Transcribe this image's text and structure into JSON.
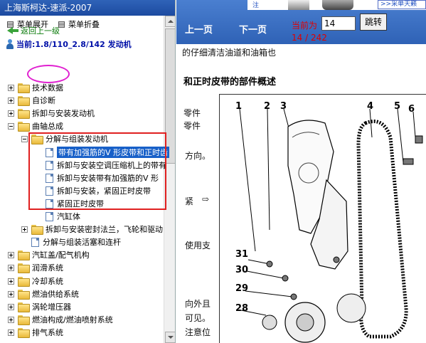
{
  "left_panel": {
    "title": "上海斯柯达-速派-2007",
    "expand_all": "菜单展开",
    "collapse_all": "菜单折叠",
    "back_link": "返回上一级",
    "current_path": "当前:1.8/110_2.8/142 发动机",
    "tree": [
      {
        "label": "技术数据",
        "level": 0,
        "type": "folder",
        "expander": "plus"
      },
      {
        "label": "自诊断",
        "level": 0,
        "type": "folder",
        "expander": "plus"
      },
      {
        "label": "拆卸与安装发动机",
        "level": 0,
        "type": "folder",
        "expander": "plus"
      },
      {
        "label": "曲轴总成",
        "level": 0,
        "type": "folder",
        "expander": "minus"
      },
      {
        "label": "分解与组装发动机",
        "level": 1,
        "type": "folder",
        "expander": "minus"
      },
      {
        "label": "带有加强筋的V 形皮带和正时齿",
        "level": 2,
        "type": "doc",
        "selected": true
      },
      {
        "label": "拆卸与安装空调压缩机上的带有",
        "level": 2,
        "type": "doc"
      },
      {
        "label": "拆卸与安装带有加强筋的V 形",
        "level": 2,
        "type": "doc"
      },
      {
        "label": "拆卸与安装，紧固正时皮带",
        "level": 2,
        "type": "doc"
      },
      {
        "label": "紧固正时皮带",
        "level": 2,
        "type": "doc"
      },
      {
        "label": "汽缸体",
        "level": 2,
        "type": "doc"
      },
      {
        "label": "拆卸与安装密封法兰，飞轮和驱动",
        "level": 1,
        "type": "folder",
        "expander": "plus"
      },
      {
        "label": "分解与组装活塞和连杆",
        "level": 1,
        "type": "doc"
      },
      {
        "label": "汽缸盖/配气机构",
        "level": 0,
        "type": "folder",
        "expander": "plus"
      },
      {
        "label": "润滑系统",
        "level": 0,
        "type": "folder",
        "expander": "plus"
      },
      {
        "label": "冷却系统",
        "level": 0,
        "type": "folder",
        "expander": "plus"
      },
      {
        "label": "燃油供给系统",
        "level": 0,
        "type": "folder",
        "expander": "plus"
      },
      {
        "label": "涡轮增压器",
        "level": 0,
        "type": "folder",
        "expander": "plus"
      },
      {
        "label": "燃油构成/燃油喷射系统",
        "level": 0,
        "type": "folder",
        "expander": "plus"
      },
      {
        "label": "排气系统",
        "level": 0,
        "type": "folder",
        "expander": "plus"
      }
    ]
  },
  "toolbar": {
    "prev": "上一页",
    "next": "下一页",
    "current_label": "当前为",
    "page_value": "14",
    "go": "跳转",
    "page_count": "14 / 242",
    "top_link": ">>采单天籁",
    "top_partial": "注"
  },
  "document": {
    "line1": "的仔细清洁油道和油箱也",
    "heading": "和正时皮带的部件概述",
    "t1": "零件",
    "t2": "零件",
    "t3": "方向。",
    "t4": "紧",
    "t5": "使用支",
    "t6": "向外且",
    "t7": "可见。",
    "t8": "注意位",
    "arrow": "⇨",
    "callouts": [
      "1",
      "2",
      "3",
      "4",
      "5",
      "6",
      "31",
      "30",
      "29",
      "28"
    ]
  }
}
